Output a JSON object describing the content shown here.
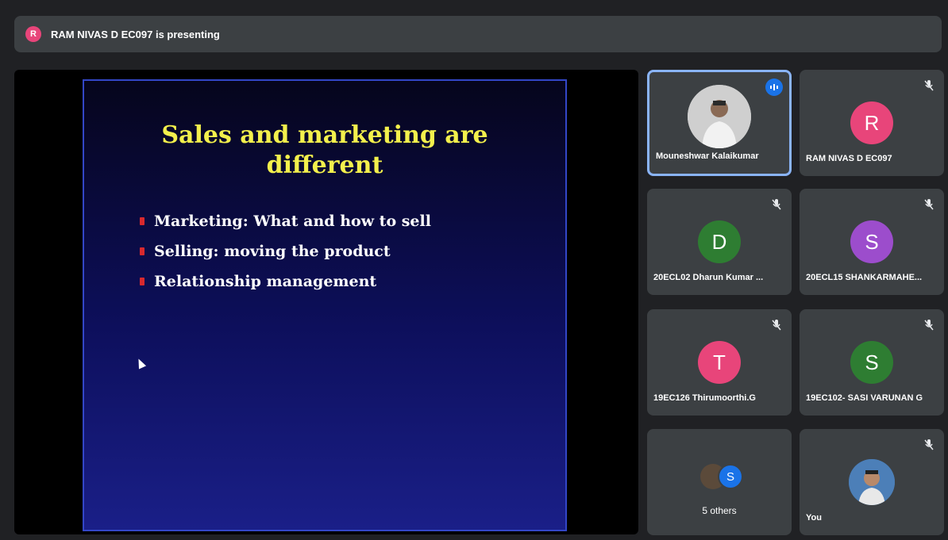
{
  "presenter": {
    "initial": "R",
    "text": "RAM NIVAS D EC097 is presenting"
  },
  "slide": {
    "title_line1": "Sales and marketing are",
    "title_line2": "different",
    "bullets": [
      "Marketing: What and how to sell",
      "Selling: moving the product",
      "Relationship management"
    ]
  },
  "participants": [
    {
      "name": "Mouneshwar Kalaikumar",
      "type": "photo",
      "state": "speaking"
    },
    {
      "name": "RAM NIVAS D EC097",
      "initial": "R",
      "color": "#e8457a",
      "state": "muted"
    },
    {
      "name": "20ECL02 Dharun Kumar ...",
      "initial": "D",
      "color": "#2e7d32",
      "state": "muted"
    },
    {
      "name": "20ECL15 SHANKARMAHE...",
      "initial": "S",
      "color": "#9c4dcc",
      "state": "muted"
    },
    {
      "name": "19EC126 Thirumoorthi.G",
      "initial": "T",
      "color": "#e8457a",
      "state": "muted"
    },
    {
      "name": "19EC102- SASI VARUNAN G",
      "initial": "S",
      "color": "#2e7d32",
      "state": "muted"
    },
    {
      "name": "5 others",
      "initial": "S",
      "color": "#1a73e8"
    },
    {
      "name": "You",
      "type": "photo",
      "state": "muted"
    }
  ]
}
